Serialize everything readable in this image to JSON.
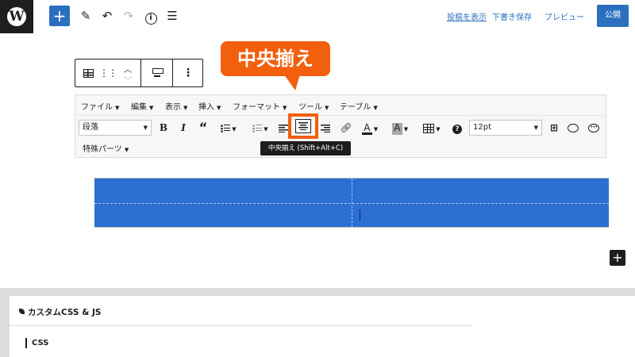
{
  "topbar": {
    "logo_glyph": "W",
    "add_glyph": "+",
    "tools_icon_names": [
      "pencil-icon",
      "undo-icon",
      "redo-icon",
      "info-icon",
      "list-view-icon"
    ],
    "save_draft_link": "投稿を表示",
    "save_draft_label": "下書き保存",
    "preview_label": "プレビュー",
    "publish_label": "公開"
  },
  "callout": {
    "text": "中央揃え",
    "color": "#f25f0d"
  },
  "classic_editor": {
    "menu": [
      {
        "label": "ファイル"
      },
      {
        "label": "編集"
      },
      {
        "label": "表示"
      },
      {
        "label": "挿入"
      },
      {
        "label": "フォーマット"
      },
      {
        "label": "ツール"
      },
      {
        "label": "テーブル"
      }
    ],
    "format_select": "段落",
    "font_size_select": "12pt",
    "special_parts_label": "特殊パーツ",
    "tooltip": "中央揃え (Shift+Alt+C)"
  },
  "meta": {
    "box_title": "カスタムCSS & JS",
    "css_label": "CSS"
  },
  "colors": {
    "accent": "#2b6fbf",
    "table_bg": "#2a6fd1",
    "highlight": "#f25f0d"
  }
}
